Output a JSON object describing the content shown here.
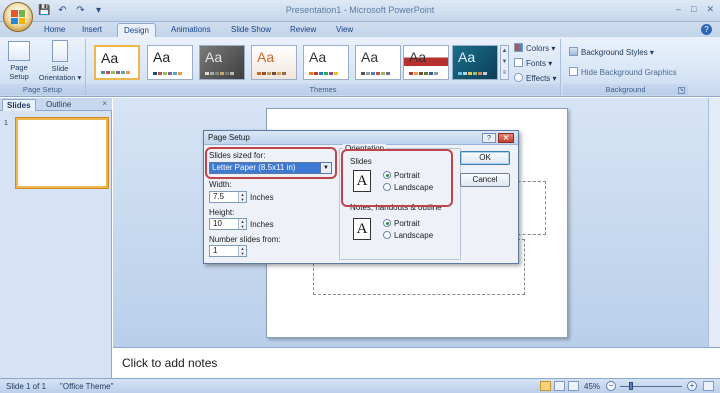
{
  "titlebar": {
    "title": "Presentation1 - Microsoft PowerPoint",
    "qat": {
      "save": "💾",
      "undo": "↶",
      "redo": "↷",
      "more": "▾"
    },
    "controls": {
      "minimize": "–",
      "maximize": "□",
      "close": "✕"
    }
  },
  "tabs": [
    "Home",
    "Insert",
    "Design",
    "Animations",
    "Slide Show",
    "Review",
    "View"
  ],
  "active_tab": "Design",
  "ribbon": {
    "page_setup_group": {
      "label": "Page Setup",
      "page_setup": "Page Setup",
      "orientation": "Slide Orientation ▾"
    },
    "themes_group": {
      "label": "Themes",
      "theme_sample": "Aa",
      "scroll": {
        "up": "▲",
        "down": "▼",
        "more": "≡"
      },
      "commands": {
        "colors": "Colors ▾",
        "fonts": "Fonts ▾",
        "effects": "Effects ▾"
      }
    },
    "background_group": {
      "label": "Background",
      "styles": "Background Styles ▾",
      "hide": "Hide Background Graphics"
    }
  },
  "left_pane": {
    "tabs": [
      "Slides",
      "Outline"
    ],
    "close": "×",
    "slide_number": "1"
  },
  "notes_placeholder": "Click to add notes",
  "status": {
    "slide": "Slide 1 of 1",
    "theme": "\"Office Theme\"",
    "zoom": "45%",
    "zoom_out": "−",
    "zoom_in": "+"
  },
  "dialog": {
    "title": "Page Setup",
    "help": "?",
    "close": "✕",
    "sized_for_label": "Slides sized for:",
    "sized_for_value": "Letter Paper (8.5x11 in)",
    "width_label": "Width:",
    "width_value": "7.5",
    "height_label": "Height:",
    "height_value": "10",
    "units": "Inches",
    "number_from_label": "Number slides from:",
    "number_from_value": "1",
    "orientation_label": "Orientation",
    "slides_label": "Slides",
    "notes_label": "Notes, handouts & outline",
    "portrait": "Portrait",
    "landscape": "Landscape",
    "doc_icon": "A",
    "ok": "OK",
    "cancel": "Cancel"
  },
  "colors": {
    "ribbon": "#d9e6f6",
    "accent_highlight": "#c0444b",
    "selection": "#3d78d2",
    "thumb_border": "#f0b64d"
  }
}
